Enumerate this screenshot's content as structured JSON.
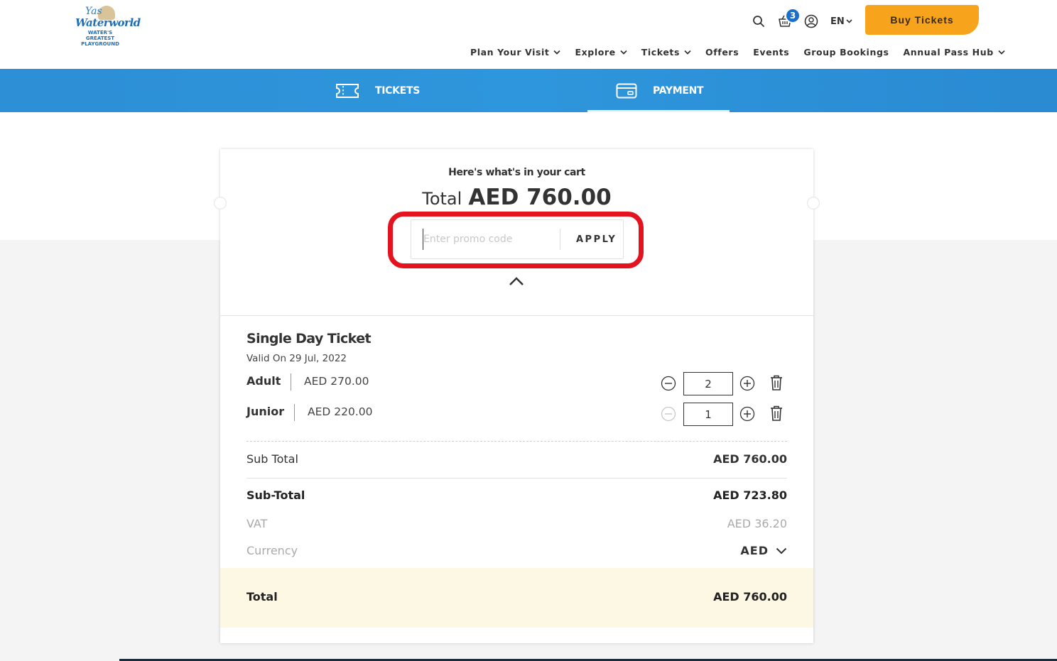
{
  "brand": {
    "logo_line1": "Yas",
    "logo_line2": "Waterworld",
    "logo_tagline": "WATER'S GREATEST PLAYGROUND"
  },
  "header": {
    "cart_count": "3",
    "language": "EN",
    "buy_tickets_label": "Buy Tickets",
    "nav": [
      {
        "label": "Plan Your Visit",
        "has_dropdown": true
      },
      {
        "label": "Explore",
        "has_dropdown": true
      },
      {
        "label": "Tickets",
        "has_dropdown": true
      },
      {
        "label": "Offers",
        "has_dropdown": false
      },
      {
        "label": "Events",
        "has_dropdown": false
      },
      {
        "label": "Group Bookings",
        "has_dropdown": false
      },
      {
        "label": "Annual Pass Hub",
        "has_dropdown": true
      }
    ]
  },
  "steps": {
    "tickets_label": "TICKETS",
    "payment_label": "PAYMENT",
    "active": "payment"
  },
  "cart": {
    "heading": "Here's what's in your cart",
    "total_label": "Total",
    "total_value": "AED 760.00",
    "promo_placeholder": "Enter promo code",
    "apply_label": "APPLY",
    "ticket": {
      "title": "Single Day Ticket",
      "valid": "Valid On 29 Jul, 2022",
      "items": [
        {
          "name": "Adult",
          "price": "AED 270.00",
          "qty": "2"
        },
        {
          "name": "Junior",
          "price": "AED 220.00",
          "qty": "1"
        }
      ]
    },
    "summary": {
      "subtotal_label": "Sub Total",
      "subtotal_value": "AED 760.00",
      "subtotal2_label": "Sub-Total",
      "subtotal2_value": "AED 723.80",
      "vat_label": "VAT",
      "vat_value": "AED 36.20",
      "currency_label": "Currency",
      "currency_value": "AED",
      "total_label": "Total",
      "total_value": "AED 760.00"
    }
  },
  "colors": {
    "accent_orange": "#f8a31c",
    "step_blue": "#2d8fd6",
    "badge_blue": "#1c6fc9",
    "highlight_red": "#e3141f",
    "total_band": "#fdf8e4"
  }
}
